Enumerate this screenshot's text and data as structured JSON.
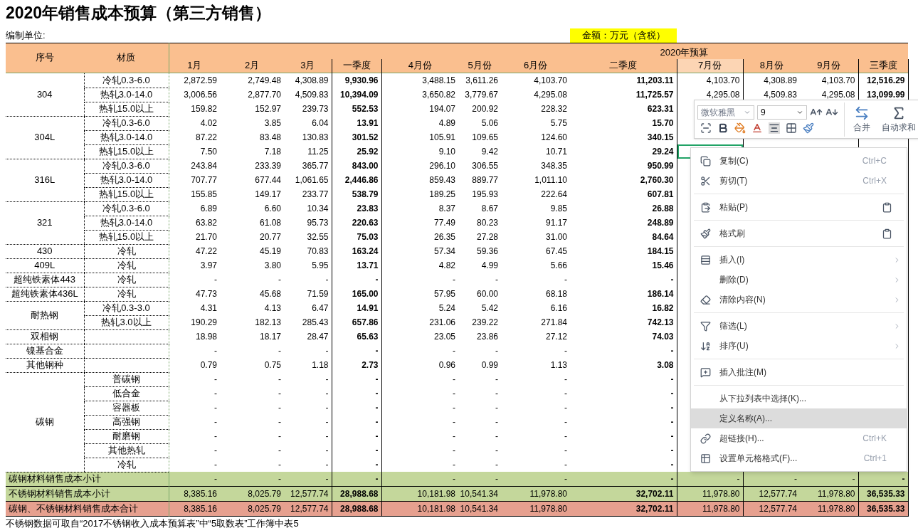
{
  "title": "2020年销售成本预算（第三方销售）",
  "unit_label": "编制单位:",
  "amount_note": "金额：万元（含税）",
  "header": {
    "seq": "序号",
    "material": "材质",
    "group": "2020年预算",
    "columns": [
      {
        "label": "1月",
        "kind": "month",
        "highlighted": false
      },
      {
        "label": "2月",
        "kind": "month",
        "highlighted": false
      },
      {
        "label": "3月",
        "kind": "month",
        "highlighted": false
      },
      {
        "label": "一季度",
        "kind": "quarter",
        "highlighted": false
      },
      {
        "label": "4月份",
        "kind": "month",
        "highlighted": false
      },
      {
        "label": "5月份",
        "kind": "month",
        "highlighted": false
      },
      {
        "label": "6月份",
        "kind": "month",
        "highlighted": false
      },
      {
        "label": "二季度",
        "kind": "quarter",
        "highlighted": false
      },
      {
        "label": "7月份",
        "kind": "month",
        "highlighted": true
      },
      {
        "label": "8月份",
        "kind": "month",
        "highlighted": false
      },
      {
        "label": "9月份",
        "kind": "month",
        "highlighted": false
      },
      {
        "label": "三季度",
        "kind": "quarter",
        "highlighted": false
      }
    ]
  },
  "groups": [
    {
      "grade": "304",
      "items": [
        {
          "material": "冷轧0.3-6.0",
          "active": false,
          "values": [
            "2,872.59",
            "2,749.48",
            "4,308.89",
            "9,930.96",
            "3,488.15",
            "3,611.26",
            "4,103.70",
            "11,203.11",
            "4,103.70",
            "4,308.89",
            "4,103.70",
            "12,516.29"
          ]
        },
        {
          "material": "热轧3.0-14.0",
          "active": false,
          "values": [
            "3,006.56",
            "2,877.70",
            "4,509.83",
            "10,394.09",
            "3,650.82",
            "3,779.67",
            "4,295.08",
            "11,725.57",
            "4,295.08",
            "4,509.83",
            "4,295.08",
            "13,099.99"
          ]
        },
        {
          "material": "热轧15.0以上",
          "active": false,
          "values": [
            "159.82",
            "152.97",
            "239.73",
            "552.53",
            "194.07",
            "200.92",
            "228.32",
            "623.31"
          ]
        }
      ]
    },
    {
      "grade": "304L",
      "items": [
        {
          "material": "冷轧0.3-6.0",
          "active": false,
          "values": [
            "4.02",
            "3.85",
            "6.04",
            "13.91",
            "4.89",
            "5.06",
            "5.75",
            "15.70"
          ]
        },
        {
          "material": "热轧3.0-14.0",
          "active": false,
          "values": [
            "87.22",
            "83.48",
            "130.83",
            "301.52",
            "105.91",
            "109.65",
            "124.60",
            "340.15"
          ]
        },
        {
          "material": "热轧15.0以上",
          "active": true,
          "values": [
            "7.50",
            "7.18",
            "11.25",
            "25.92",
            "9.10",
            "9.42",
            "10.71",
            "29.24"
          ]
        }
      ]
    },
    {
      "grade": "316L",
      "items": [
        {
          "material": "冷轧0.3-6.0",
          "active": false,
          "values": [
            "243.84",
            "233.39",
            "365.77",
            "843.00",
            "296.10",
            "306.55",
            "348.35",
            "950.99"
          ]
        },
        {
          "material": "热轧3.0-14.0",
          "active": false,
          "values": [
            "707.77",
            "677.44",
            "1,061.65",
            "2,446.86",
            "859.43",
            "889.77",
            "1,011.10",
            "2,760.30"
          ]
        },
        {
          "material": "热轧15.0以上",
          "active": false,
          "values": [
            "155.85",
            "149.17",
            "233.77",
            "538.79",
            "189.25",
            "195.93",
            "222.64",
            "607.81"
          ]
        }
      ]
    },
    {
      "grade": "321",
      "items": [
        {
          "material": "冷轧0.3-6.0",
          "active": false,
          "values": [
            "6.89",
            "6.60",
            "10.34",
            "23.83",
            "8.37",
            "8.67",
            "9.85",
            "26.88"
          ]
        },
        {
          "material": "热轧3.0-14.0",
          "active": false,
          "values": [
            "63.82",
            "61.08",
            "95.73",
            "220.63",
            "77.49",
            "80.23",
            "91.17",
            "248.89"
          ]
        },
        {
          "material": "热轧15.0以上",
          "active": false,
          "values": [
            "21.70",
            "20.77",
            "32.55",
            "75.03",
            "26.35",
            "27.28",
            "31.00",
            "84.64"
          ]
        }
      ]
    },
    {
      "grade": "430",
      "items": [
        {
          "material": "冷轧",
          "active": false,
          "values": [
            "47.22",
            "45.19",
            "70.83",
            "163.24",
            "57.34",
            "59.36",
            "67.45",
            "184.15"
          ]
        }
      ]
    },
    {
      "grade": "409L",
      "items": [
        {
          "material": "冷轧",
          "active": false,
          "values": [
            "3.97",
            "3.80",
            "5.95",
            "13.71",
            "4.82",
            "4.99",
            "5.66",
            "15.46"
          ]
        }
      ]
    },
    {
      "grade": "超纯铁素体443",
      "items": [
        {
          "material": "冷轧",
          "active": false,
          "values": [
            "-",
            "-",
            "-",
            "-",
            "-",
            "-",
            "-",
            "-"
          ]
        }
      ]
    },
    {
      "grade": "超纯铁素体436L",
      "items": [
        {
          "material": "冷轧",
          "active": false,
          "values": [
            "47.73",
            "45.68",
            "71.59",
            "165.00",
            "57.95",
            "60.00",
            "68.18",
            "186.14"
          ]
        }
      ]
    },
    {
      "grade": "耐热钢",
      "items": [
        {
          "material": "冷轧0.3-3.0",
          "active": false,
          "values": [
            "4.31",
            "4.13",
            "6.47",
            "14.91",
            "5.24",
            "5.42",
            "6.16",
            "16.82"
          ]
        },
        {
          "material": "热轧3.0以上",
          "active": false,
          "values": [
            "190.29",
            "182.13",
            "285.43",
            "657.86",
            "231.06",
            "239.22",
            "271.84",
            "742.13"
          ]
        }
      ]
    },
    {
      "grade": "双相钢",
      "items": [
        {
          "active": false,
          "values": [
            "18.98",
            "18.17",
            "28.47",
            "65.63",
            "23.05",
            "23.86",
            "27.12",
            "74.03"
          ]
        }
      ]
    },
    {
      "grade": "镍基合金",
      "items": [
        {
          "active": false,
          "values": [
            "-",
            "-",
            "-",
            "-",
            "-",
            "-",
            "-",
            "-"
          ]
        }
      ]
    },
    {
      "grade": "其他钢种",
      "items": [
        {
          "active": false,
          "values": [
            "0.79",
            "0.75",
            "1.18",
            "2.73",
            "0.96",
            "0.99",
            "1.13",
            "3.08"
          ]
        }
      ]
    },
    {
      "grade": "碳钢",
      "items": [
        {
          "material": "普碳钢",
          "active": false,
          "values": [
            "-",
            "-",
            "-",
            "-",
            "-",
            "-",
            "-",
            "-"
          ]
        },
        {
          "material": "低合金",
          "active": false,
          "values": [
            "-",
            "-",
            "-",
            "-",
            "-",
            "-",
            "-",
            "-"
          ]
        },
        {
          "material": "容器板",
          "active": false,
          "values": [
            "-",
            "-",
            "-",
            "-",
            "-",
            "-",
            "-",
            "-"
          ]
        },
        {
          "material": "高强钢",
          "active": false,
          "values": [
            "-",
            "-",
            "-",
            "-",
            "-",
            "-",
            "-",
            "-"
          ]
        },
        {
          "material": "耐磨钢",
          "active": false,
          "values": [
            "-",
            "-",
            "-",
            "-",
            "-",
            "-",
            "-",
            "-"
          ]
        },
        {
          "material": "其他热轧",
          "active": false,
          "values": [
            "-",
            "-",
            "-",
            "-",
            "-",
            "-",
            "-",
            "-"
          ]
        },
        {
          "material": "冷轧",
          "active": false,
          "values": [
            "-",
            "-",
            "-",
            "-",
            "-",
            "-",
            "-",
            "-"
          ]
        }
      ]
    }
  ],
  "totals": [
    {
      "kind": "subtotal",
      "label": "碳钢材料销售成本小计",
      "values": [
        "-",
        "-",
        "-",
        "-",
        "-",
        "-",
        "-",
        "-",
        "-",
        "-",
        "-",
        "-"
      ]
    },
    {
      "kind": "subtotal",
      "label": "不锈钢材料销售成本小计",
      "values": [
        "8,385.16",
        "8,025.79",
        "12,577.74",
        "28,988.68",
        "10,181.98",
        "10,541.34",
        "11,978.80",
        "32,702.11",
        "11,978.80",
        "12,577.74",
        "11,978.80",
        "36,535.33"
      ]
    },
    {
      "kind": "total",
      "label": "碳钢、不锈钢材料销售成本合计",
      "values": [
        "8,385.16",
        "8,025.79",
        "12,577.74",
        "28,988.68",
        "10,181.98",
        "10,541.34",
        "11,978.80",
        "32,702.11",
        "11,978.80",
        "12,577.74",
        "11,978.80",
        "36,535.33"
      ]
    }
  ],
  "footnote": "不锈钢数据可取自“2017不锈钢收入成本预算表”中“5取数表”工作簿中表5",
  "toolbar": {
    "font": "微软雅黑",
    "size": "9",
    "merge": "合并",
    "autosum": "自动求和"
  },
  "context_menu": [
    {
      "kind": "item",
      "label": "复制(C)",
      "shortcut": "Ctrl+C",
      "submenu": false,
      "selected": false
    },
    {
      "kind": "item",
      "label": "剪切(T)",
      "shortcut": "Ctrl+X",
      "submenu": false,
      "selected": false
    },
    {
      "kind": "separator"
    },
    {
      "kind": "tool-item",
      "label": "粘贴(P)",
      "submenu": false,
      "selected": false
    },
    {
      "kind": "separator"
    },
    {
      "kind": "tool-item",
      "label": "格式刷",
      "submenu": false,
      "selected": false
    },
    {
      "kind": "separator"
    },
    {
      "kind": "item",
      "label": "插入(I)",
      "submenu": true,
      "selected": false
    },
    {
      "kind": "item",
      "label": "删除(D)",
      "submenu": true,
      "selected": false
    },
    {
      "kind": "item",
      "label": "清除内容(N)",
      "submenu": true,
      "selected": false
    },
    {
      "kind": "separator"
    },
    {
      "kind": "item",
      "label": "筛选(L)",
      "submenu": true,
      "selected": false
    },
    {
      "kind": "item",
      "label": "排序(U)",
      "submenu": true,
      "selected": false
    },
    {
      "kind": "separator"
    },
    {
      "kind": "item",
      "label": "插入批注(M)",
      "submenu": false,
      "selected": false
    },
    {
      "kind": "separator"
    },
    {
      "kind": "item",
      "label": "从下拉列表中选择(K)...",
      "submenu": false,
      "selected": false
    },
    {
      "kind": "item",
      "label": "定义名称(A)...",
      "submenu": false,
      "selected": true
    },
    {
      "kind": "item",
      "label": "超链接(H)...",
      "shortcut": "Ctrl+K",
      "submenu": false,
      "selected": false
    },
    {
      "kind": "item",
      "label": "设置单元格格式(F)...",
      "shortcut": "Ctrl+1",
      "submenu": false,
      "selected": false
    }
  ]
}
